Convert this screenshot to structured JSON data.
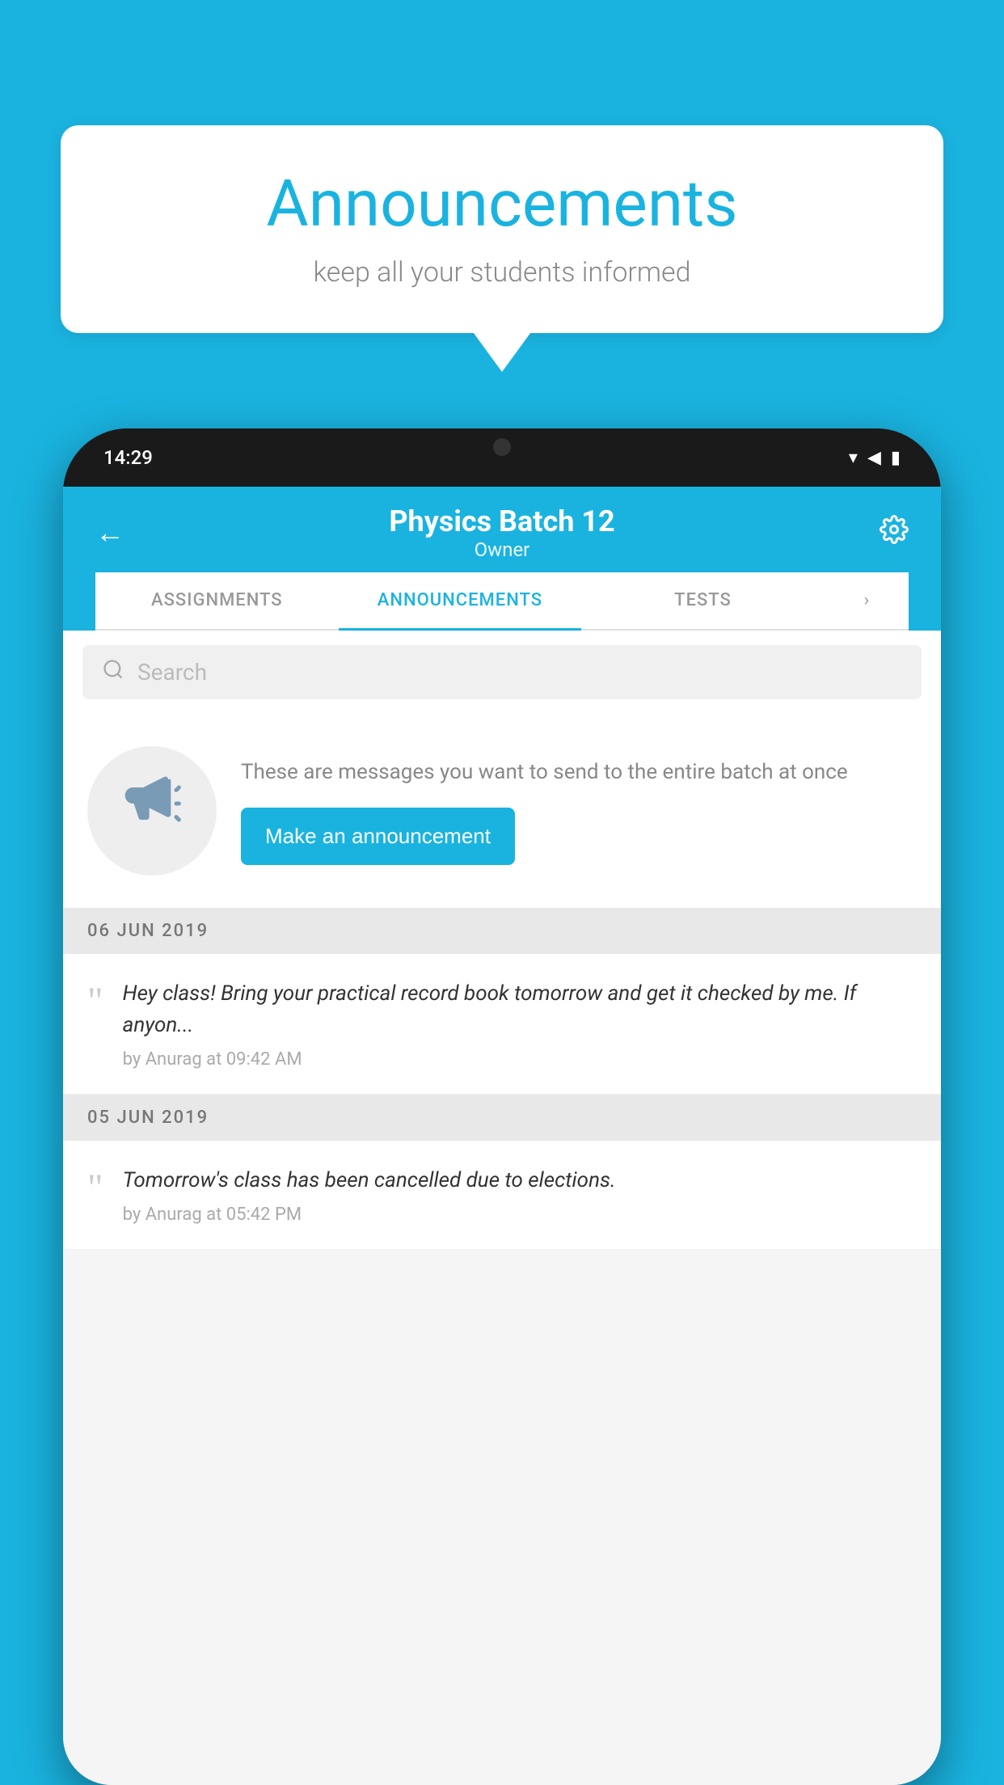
{
  "page": {
    "background_color": "#1ab3e0"
  },
  "speech_bubble": {
    "title": "Announcements",
    "subtitle": "keep all your students informed"
  },
  "phone": {
    "status_bar": {
      "time": "14:29"
    },
    "header": {
      "title": "Physics Batch 12",
      "subtitle": "Owner",
      "back_label": "←",
      "settings_label": "⚙"
    },
    "tabs": [
      {
        "label": "ASSIGNMENTS",
        "active": false
      },
      {
        "label": "ANNOUNCEMENTS",
        "active": true
      },
      {
        "label": "TESTS",
        "active": false
      }
    ],
    "search": {
      "placeholder": "Search"
    },
    "promo": {
      "text": "These are messages you want to send to the entire batch at once",
      "button_label": "Make an announcement"
    },
    "announcements": [
      {
        "date": "06  JUN  2019",
        "text": "Hey class! Bring your practical record book tomorrow and get it checked by me. If anyon...",
        "meta": "by Anurag at 09:42 AM"
      },
      {
        "date": "05  JUN  2019",
        "text": "Tomorrow's class has been cancelled due to elections.",
        "meta": "by Anurag at 05:42 PM"
      }
    ]
  }
}
